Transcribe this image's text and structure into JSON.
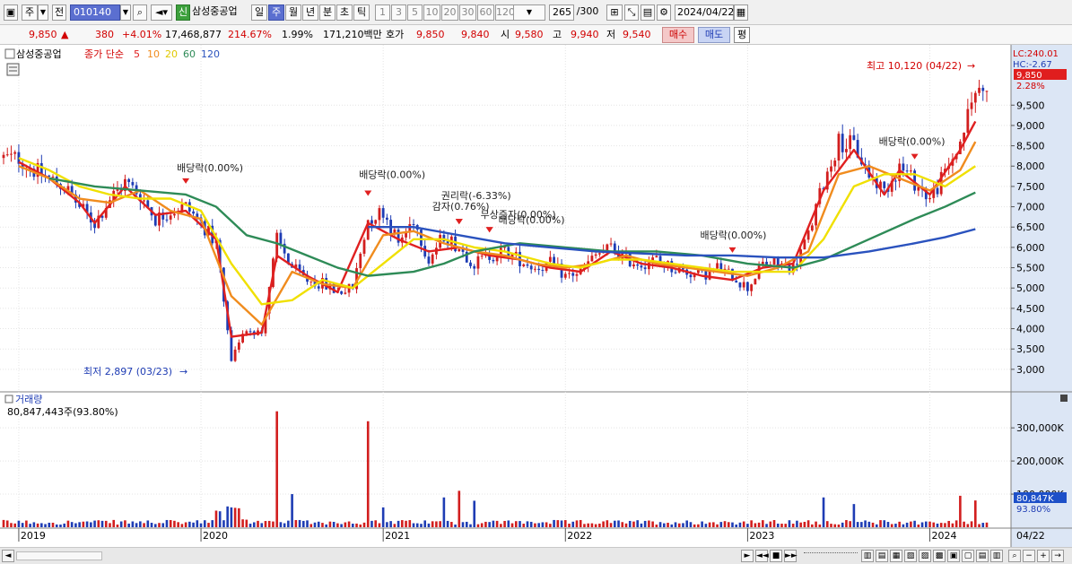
{
  "toolbar": {
    "mode": "주",
    "market": "전",
    "code": "010140",
    "name_badge": "신",
    "name": "삼성중공업",
    "periods": [
      "일",
      "주",
      "월",
      "년",
      "분",
      "초",
      "틱"
    ],
    "selected_period": "주",
    "intervals": [
      "1",
      "3",
      "5",
      "10",
      "20",
      "30",
      "60",
      "120"
    ],
    "count": "265",
    "count_total": "/300",
    "date": "2024/04/22"
  },
  "quote": {
    "price": "9,850",
    "arrow": "▲",
    "change": "380",
    "change_pct": "+4.01%",
    "volume": "17,468,877",
    "vol_ratio": "214.67%",
    "turnover": "1.99%",
    "amount": "171,210백만",
    "ask_label": "호가",
    "ask": "9,850",
    "bid": "9,840",
    "open_label": "시",
    "open": "9,580",
    "high_label": "고",
    "high": "9,940",
    "low_label": "저",
    "low": "9,540",
    "buy": "매수",
    "sell": "매도",
    "avg": "평"
  },
  "legend": {
    "name": "삼성중공업",
    "label": "종가 단순",
    "mas": [
      {
        "period": "5",
        "color": "#e02020"
      },
      {
        "period": "10",
        "color": "#f08c1e"
      },
      {
        "period": "20",
        "color": "#f0e000"
      },
      {
        "period": "60",
        "color": "#2e8b57"
      },
      {
        "period": "120",
        "color": "#2a52be"
      }
    ]
  },
  "annotations": {
    "max_label": "최고 10,120 (04/22)",
    "min_label": "최저 2,897 (03/23)",
    "events": [
      {
        "text": "배당락(0.00%)",
        "date": "2019-12"
      },
      {
        "text": "배당락(0.00%)",
        "date": "2020-12"
      },
      {
        "text": "권리락(-6.33%)",
        "date": "2021-06"
      },
      {
        "text": "감자(0.76%)",
        "date": "2021-06"
      },
      {
        "text": "무상증자(0.00%)",
        "date": "2021-08"
      },
      {
        "text": "배당락(0.00%)",
        "date": "2021-08"
      },
      {
        "text": "배당락(0.00%)",
        "date": "2022-12"
      },
      {
        "text": "배당락(0.00%)",
        "date": "2023-12"
      }
    ]
  },
  "right_axis": {
    "lc": "LC:240.01",
    "hc": "HC:-2.67",
    "last_price": "9,850",
    "last_pct": "2.28%",
    "vol_tag": "80,847K",
    "vol_pct": "93.80%"
  },
  "volume_panel": {
    "title": "거래량",
    "value": "80,847,443주(93.80%)"
  },
  "x_axis": {
    "labels": [
      "2019",
      "2020",
      "2021",
      "2022",
      "2023",
      "2024"
    ],
    "cursor": "04/22"
  },
  "colors": {
    "up": "#d21e1e",
    "down": "#1e3cb4",
    "grid": "#c8c8c8",
    "axis_bg": "#dce6f5"
  },
  "chart_data": {
    "type": "candlestick",
    "x_start": "2018-12",
    "x_end": "2024-04",
    "x_unit": "week",
    "price_ylim": [
      2600,
      10300
    ],
    "price_ticks": [
      3000,
      3500,
      4000,
      4500,
      5000,
      5500,
      6000,
      6500,
      7000,
      7500,
      8000,
      8500,
      9000,
      9500
    ],
    "price_tick_labels": [
      "3,000",
      "3,500",
      "4,000",
      "4,500",
      "5,000",
      "5,500",
      "6,000",
      "6,500",
      "7,000",
      "7,500",
      "8,000",
      "8,500",
      "9,000",
      "9,500"
    ],
    "price_path": [
      [
        "2019-01",
        8200
      ],
      [
        "2019-02",
        7900
      ],
      [
        "2019-03",
        7700
      ],
      [
        "2019-04",
        7500
      ],
      [
        "2019-05",
        7000
      ],
      [
        "2019-06",
        6600
      ],
      [
        "2019-07",
        7200
      ],
      [
        "2019-08",
        7600
      ],
      [
        "2019-09",
        7300
      ],
      [
        "2019-10",
        6700
      ],
      [
        "2019-11",
        6900
      ],
      [
        "2019-12",
        7000
      ],
      [
        "2020-01",
        6600
      ],
      [
        "2020-02",
        6100
      ],
      [
        "2020-03",
        3200
      ],
      [
        "2020-04",
        4000
      ],
      [
        "2020-05",
        3900
      ],
      [
        "2020-06",
        6200
      ],
      [
        "2020-07",
        5500
      ],
      [
        "2020-08",
        5200
      ],
      [
        "2020-09",
        5100
      ],
      [
        "2020-10",
        4900
      ],
      [
        "2020-11",
        5000
      ],
      [
        "2020-12",
        6700
      ],
      [
        "2021-01",
        6900
      ],
      [
        "2021-02",
        6100
      ],
      [
        "2021-03",
        6700
      ],
      [
        "2021-04",
        5700
      ],
      [
        "2021-05",
        6300
      ],
      [
        "2021-06",
        6000
      ],
      [
        "2021-07",
        5600
      ],
      [
        "2021-08",
        5800
      ],
      [
        "2021-09",
        5900
      ],
      [
        "2021-10",
        5700
      ],
      [
        "2021-11",
        5500
      ],
      [
        "2021-12",
        5600
      ],
      [
        "2022-01",
        5300
      ],
      [
        "2022-02",
        5400
      ],
      [
        "2022-03",
        5800
      ],
      [
        "2022-04",
        6000
      ],
      [
        "2022-05",
        5700
      ],
      [
        "2022-06",
        5600
      ],
      [
        "2022-07",
        5700
      ],
      [
        "2022-08",
        5500
      ],
      [
        "2022-09",
        5400
      ],
      [
        "2022-10",
        5300
      ],
      [
        "2022-11",
        5500
      ],
      [
        "2022-12",
        5300
      ],
      [
        "2023-01",
        5000
      ],
      [
        "2023-02",
        5600
      ],
      [
        "2023-03",
        5600
      ],
      [
        "2023-04",
        5500
      ],
      [
        "2023-05",
        6300
      ],
      [
        "2023-06",
        7600
      ],
      [
        "2023-07",
        8600
      ],
      [
        "2023-08",
        8500
      ],
      [
        "2023-09",
        7800
      ],
      [
        "2023-10",
        7400
      ],
      [
        "2023-11",
        8000
      ],
      [
        "2023-12",
        7600
      ],
      [
        "2024-01",
        7200
      ],
      [
        "2024-02",
        7800
      ],
      [
        "2024-03",
        8600
      ],
      [
        "2024-04",
        9850
      ]
    ],
    "series": [
      {
        "name": "5",
        "color": "#e02020",
        "values": [
          [
            "2019-01",
            8100
          ],
          [
            "2019-03",
            7700
          ],
          [
            "2019-05",
            7100
          ],
          [
            "2019-06",
            6600
          ],
          [
            "2019-08",
            7500
          ],
          [
            "2019-10",
            6800
          ],
          [
            "2019-12",
            6900
          ],
          [
            "2020-02",
            6200
          ],
          [
            "2020-03",
            3800
          ],
          [
            "2020-05",
            3900
          ],
          [
            "2020-06",
            5800
          ],
          [
            "2020-08",
            5300
          ],
          [
            "2020-10",
            4900
          ],
          [
            "2020-12",
            6600
          ],
          [
            "2021-02",
            6200
          ],
          [
            "2021-04",
            5900
          ],
          [
            "2021-06",
            6000
          ],
          [
            "2021-08",
            5800
          ],
          [
            "2021-10",
            5700
          ],
          [
            "2021-12",
            5500
          ],
          [
            "2022-02",
            5400
          ],
          [
            "2022-04",
            5900
          ],
          [
            "2022-06",
            5600
          ],
          [
            "2022-08",
            5500
          ],
          [
            "2022-10",
            5300
          ],
          [
            "2022-12",
            5200
          ],
          [
            "2023-02",
            5500
          ],
          [
            "2023-04",
            5600
          ],
          [
            "2023-06",
            7400
          ],
          [
            "2023-08",
            8400
          ],
          [
            "2023-10",
            7300
          ],
          [
            "2023-11",
            7900
          ],
          [
            "2024-01",
            7300
          ],
          [
            "2024-03",
            8400
          ],
          [
            "2024-04",
            9100
          ]
        ]
      },
      {
        "name": "10",
        "color": "#f08c1e",
        "values": [
          [
            "2019-01",
            8000
          ],
          [
            "2019-03",
            7700
          ],
          [
            "2019-05",
            7200
          ],
          [
            "2019-07",
            7100
          ],
          [
            "2019-09",
            7400
          ],
          [
            "2019-11",
            6900
          ],
          [
            "2020-01",
            6700
          ],
          [
            "2020-03",
            4800
          ],
          [
            "2020-05",
            4100
          ],
          [
            "2020-07",
            5400
          ],
          [
            "2020-09",
            5100
          ],
          [
            "2020-11",
            5000
          ],
          [
            "2021-01",
            6300
          ],
          [
            "2021-03",
            6400
          ],
          [
            "2021-05",
            6100
          ],
          [
            "2021-07",
            5900
          ],
          [
            "2021-09",
            5800
          ],
          [
            "2021-11",
            5600
          ],
          [
            "2022-01",
            5500
          ],
          [
            "2022-03",
            5600
          ],
          [
            "2022-05",
            5800
          ],
          [
            "2022-07",
            5600
          ],
          [
            "2022-09",
            5500
          ],
          [
            "2022-11",
            5400
          ],
          [
            "2023-01",
            5300
          ],
          [
            "2023-03",
            5500
          ],
          [
            "2023-05",
            5900
          ],
          [
            "2023-07",
            7800
          ],
          [
            "2023-09",
            8000
          ],
          [
            "2023-11",
            7700
          ],
          [
            "2024-01",
            7400
          ],
          [
            "2024-03",
            7900
          ],
          [
            "2024-04",
            8600
          ]
        ]
      },
      {
        "name": "20",
        "color": "#f0e000",
        "values": [
          [
            "2019-01",
            8200
          ],
          [
            "2019-03",
            7900
          ],
          [
            "2019-05",
            7500
          ],
          [
            "2019-07",
            7300
          ],
          [
            "2019-09",
            7200
          ],
          [
            "2019-11",
            7200
          ],
          [
            "2020-01",
            6900
          ],
          [
            "2020-03",
            5600
          ],
          [
            "2020-05",
            4600
          ],
          [
            "2020-07",
            4700
          ],
          [
            "2020-09",
            5200
          ],
          [
            "2020-11",
            5000
          ],
          [
            "2021-01",
            5600
          ],
          [
            "2021-03",
            6200
          ],
          [
            "2021-05",
            6200
          ],
          [
            "2021-07",
            6000
          ],
          [
            "2021-09",
            5900
          ],
          [
            "2021-11",
            5700
          ],
          [
            "2021-12",
            5600
          ],
          [
            "2022-02",
            5500
          ],
          [
            "2022-04",
            5700
          ],
          [
            "2022-06",
            5700
          ],
          [
            "2022-08",
            5600
          ],
          [
            "2022-10",
            5500
          ],
          [
            "2022-12",
            5400
          ],
          [
            "2023-02",
            5400
          ],
          [
            "2023-04",
            5400
          ],
          [
            "2023-06",
            6200
          ],
          [
            "2023-08",
            7500
          ],
          [
            "2023-10",
            7800
          ],
          [
            "2023-12",
            7800
          ],
          [
            "2024-02",
            7500
          ],
          [
            "2024-04",
            8000
          ]
        ]
      },
      {
        "name": "60",
        "color": "#2e8b57",
        "values": [
          [
            "2019-03",
            7700
          ],
          [
            "2019-06",
            7500
          ],
          [
            "2019-09",
            7400
          ],
          [
            "2019-12",
            7300
          ],
          [
            "2020-02",
            7000
          ],
          [
            "2020-04",
            6300
          ],
          [
            "2020-06",
            6100
          ],
          [
            "2020-08",
            5800
          ],
          [
            "2020-10",
            5500
          ],
          [
            "2020-12",
            5300
          ],
          [
            "2021-03",
            5400
          ],
          [
            "2021-05",
            5600
          ],
          [
            "2021-07",
            5900
          ],
          [
            "2021-10",
            6100
          ],
          [
            "2022-01",
            6000
          ],
          [
            "2022-04",
            5900
          ],
          [
            "2022-07",
            5900
          ],
          [
            "2022-10",
            5800
          ],
          [
            "2023-01",
            5600
          ],
          [
            "2023-04",
            5500
          ],
          [
            "2023-06",
            5700
          ],
          [
            "2023-09",
            6200
          ],
          [
            "2023-12",
            6700
          ],
          [
            "2024-02",
            7000
          ],
          [
            "2024-04",
            7350
          ]
        ]
      },
      {
        "name": "120",
        "color": "#2a52be",
        "values": [
          [
            "2020-12",
            6500
          ],
          [
            "2021-03",
            6500
          ],
          [
            "2021-06",
            6300
          ],
          [
            "2021-09",
            6100
          ],
          [
            "2021-12",
            6000
          ],
          [
            "2022-03",
            5900
          ],
          [
            "2022-06",
            5850
          ],
          [
            "2022-09",
            5800
          ],
          [
            "2022-12",
            5800
          ],
          [
            "2023-03",
            5750
          ],
          [
            "2023-06",
            5750
          ],
          [
            "2023-09",
            5900
          ],
          [
            "2023-12",
            6100
          ],
          [
            "2024-02",
            6250
          ],
          [
            "2024-04",
            6450
          ]
        ]
      }
    ],
    "volume_ylim": [
      0,
      360000
    ],
    "volume_unit": "K",
    "volume_ticks": [
      100000,
      200000,
      300000
    ],
    "volume_tick_labels": [
      "100,000K",
      "200,000K",
      "300,000K"
    ],
    "volume_spikes": [
      [
        "2020-03",
        60000
      ],
      [
        "2020-06",
        350000
      ],
      [
        "2020-07",
        100000
      ],
      [
        "2020-12",
        320000
      ],
      [
        "2021-01",
        60000
      ],
      [
        "2021-05",
        90000
      ],
      [
        "2021-06",
        110000
      ],
      [
        "2021-07",
        80000
      ],
      [
        "2023-06",
        90000
      ],
      [
        "2023-08",
        70000
      ],
      [
        "2024-03",
        95000
      ],
      [
        "2024-04",
        80847
      ]
    ]
  }
}
